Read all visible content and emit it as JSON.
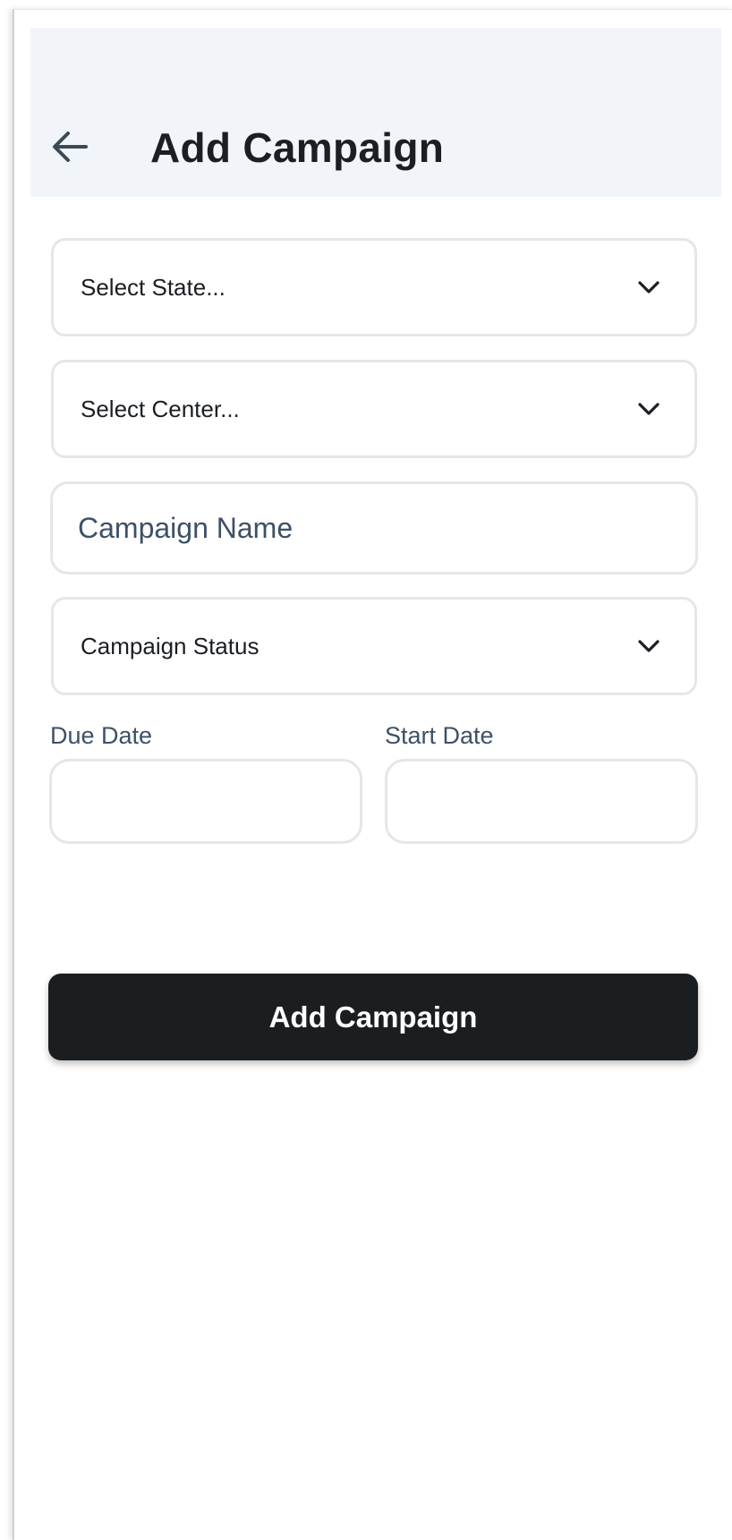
{
  "header": {
    "title": "Add Campaign",
    "back_icon": "arrow-left-icon"
  },
  "form": {
    "state_select": {
      "value": "Select State..."
    },
    "center_select": {
      "value": "Select Center..."
    },
    "campaign_name": {
      "placeholder": "Campaign Name",
      "value": ""
    },
    "campaign_status": {
      "value": "Campaign Status"
    },
    "due_date": {
      "label": "Due Date",
      "value": ""
    },
    "start_date": {
      "label": "Start Date",
      "value": ""
    },
    "dropdown_icon": "chevron-down-icon"
  },
  "actions": {
    "submit_label": "Add Campaign"
  },
  "colors": {
    "header_bg": "#f1f5fa",
    "title_text": "#1b1f23",
    "muted_text": "#3d5166",
    "border": "#e4e6ea",
    "button_bg": "#1b1e21",
    "button_text": "#ffffff"
  }
}
